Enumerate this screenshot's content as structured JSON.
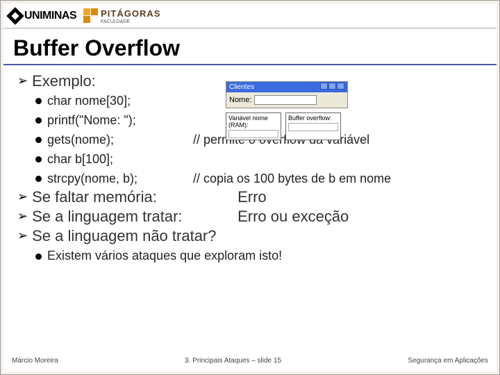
{
  "logos": {
    "uniminas": "UNIMINAS",
    "pitagoras": "PITÁGORAS",
    "pitagoras_sub": "FACULDADE"
  },
  "title": "Buffer Overflow",
  "bullets": {
    "exemplo": "Exemplo:",
    "code": [
      "char nome[30];",
      "printf(\"Nome: \");",
      "gets(nome);",
      "char b[100];",
      "strcpy(nome, b);"
    ],
    "comments": {
      "gets": "// permite o overflow da variável",
      "strcpy": "// copia os 100 bytes de b em nome"
    },
    "mem": "Se faltar memória:",
    "mem_result": "Erro",
    "lang_treat": "Se a linguagem tratar:",
    "lang_treat_result": "Erro ou exceção",
    "lang_notreat": "Se a linguagem não tratar?",
    "attacks": "Existem vários ataques que exploram isto!"
  },
  "illustration": {
    "window_title": "Clientes",
    "field_label": "Nome:",
    "box1_label": "Variável nome (RAM):",
    "box2_label": "Buffer overflow:"
  },
  "footer": {
    "left": "Márcio Moreira",
    "center": "3. Principais Ataques – slide 15",
    "right": "Segurança em Aplicações"
  }
}
